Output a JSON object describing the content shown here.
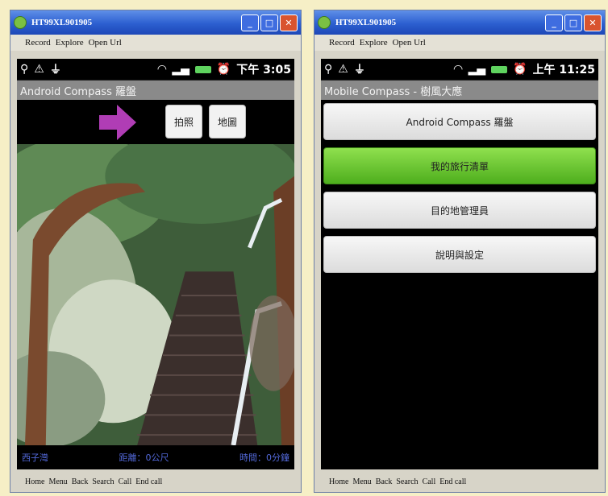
{
  "window1": {
    "title": "HT99XL901905",
    "menu": [
      "Record",
      "Explore",
      "Open Url"
    ],
    "status_time": "下午 3:05",
    "app_title": "Android Compass 羅盤",
    "buttons": {
      "camera": "拍照",
      "map": "地圖"
    },
    "info": {
      "left": "西子灣",
      "middle": "距離：0公尺",
      "right": "時間：0分鐘"
    },
    "keys": [
      "Home",
      "Menu",
      "Back",
      "Search",
      "Call",
      "End call"
    ]
  },
  "window2": {
    "title": "HT99XL901905",
    "menu": [
      "Record",
      "Explore",
      "Open Url"
    ],
    "status_time": "上午 11:25",
    "app_title": "Mobile Compass - 樹風大應",
    "menu_items": [
      "Android Compass 羅盤",
      "我的旅行清單",
      "目的地管理員",
      "說明與設定"
    ],
    "keys": [
      "Home",
      "Menu",
      "Back",
      "Search",
      "Call",
      "End call"
    ]
  },
  "colors": {
    "arrow": "#b03db5",
    "highlight": "#5cc229",
    "titlebar": "#2c5fd0",
    "info_text": "#5268d8"
  },
  "icons": [
    "app-icon",
    "gps-icon",
    "warning-icon",
    "usb-icon",
    "wifi-icon",
    "signal-icon",
    "battery-icon",
    "alarm-icon",
    "minimize-icon",
    "maximize-icon",
    "close-icon",
    "arrow-right-icon"
  ]
}
